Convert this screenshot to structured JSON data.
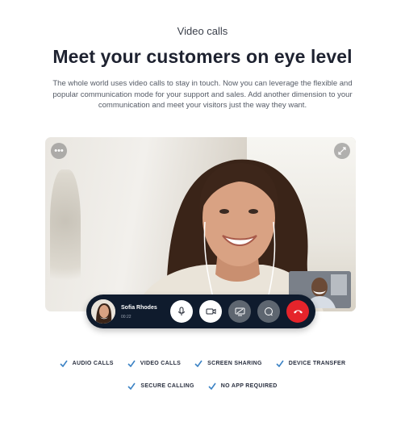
{
  "section": {
    "eyebrow": "Video calls",
    "headline": "Meet your customers on eye level",
    "intro": "The whole world uses video calls to stay in touch. Now you can leverage the flexible and popular communication mode for your support and sales. Add another dimension to your communication and meet your visitors just the way they want."
  },
  "video": {
    "menu_icon": "more-dots-icon",
    "expand_icon": "expand-icon",
    "caller": {
      "name": "Sofia Rhodes",
      "duration": "00:22"
    },
    "controls": [
      {
        "name": "microphone",
        "icon": "microphone-icon"
      },
      {
        "name": "camera",
        "icon": "video-camera-icon"
      },
      {
        "name": "screen-share",
        "icon": "screen-share-icon"
      },
      {
        "name": "chat",
        "icon": "chat-bubble-icon"
      },
      {
        "name": "hang-up",
        "icon": "phone-hangup-icon"
      }
    ]
  },
  "features": {
    "row1": [
      "AUDIO CALLS",
      "VIDEO CALLS",
      "SCREEN SHARING",
      "DEVICE TRANSFER"
    ],
    "row2": [
      "SECURE CALLING",
      "NO APP REQUIRED"
    ]
  },
  "colors": {
    "accent": "#3b82c4",
    "hangup": "#e5242b",
    "callbar": "#0f1b2d",
    "heading": "#1e2230"
  }
}
